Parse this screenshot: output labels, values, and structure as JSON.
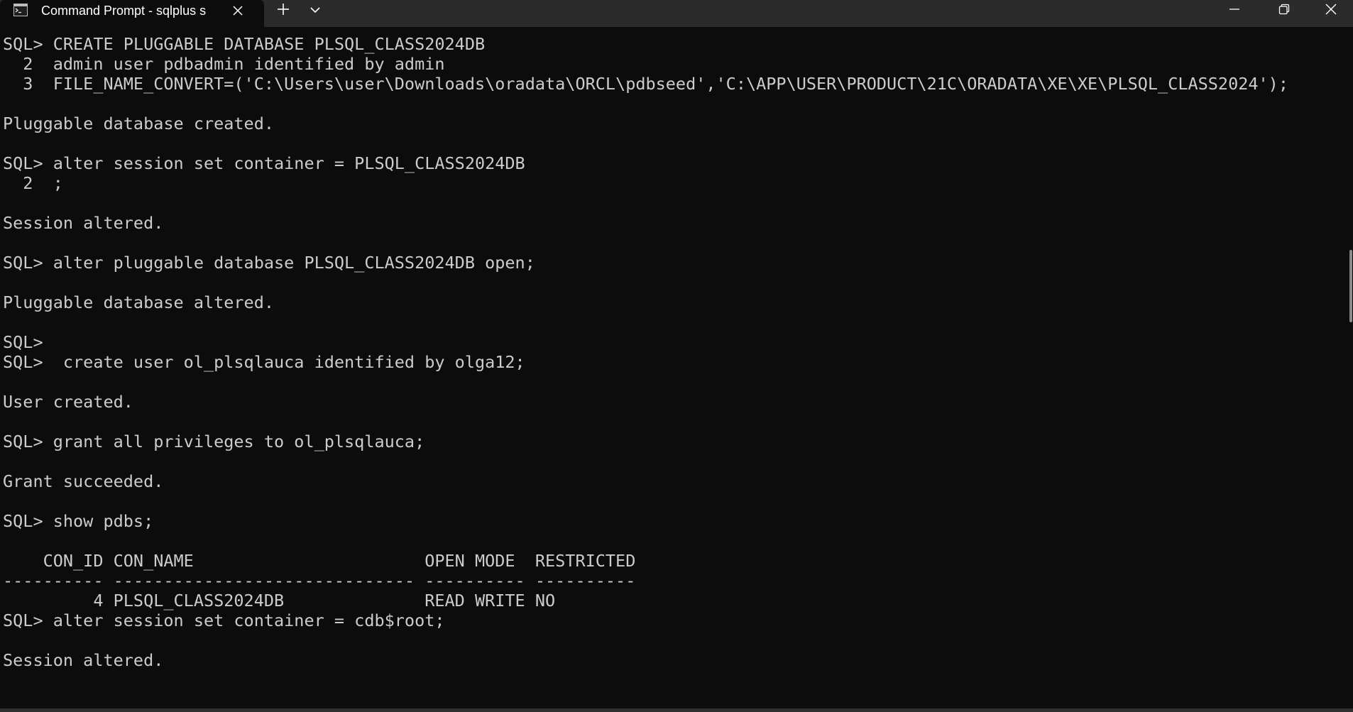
{
  "window": {
    "tab_title": "Command Prompt - sqlplus s",
    "icons": {
      "tab": "terminal-icon",
      "tab_close": "close-icon",
      "new_tab": "plus-icon",
      "dropdown": "chevron-down-icon",
      "minimize": "minimize-icon",
      "maximize": "restore-icon",
      "close": "close-icon"
    }
  },
  "colors": {
    "terminal_background": "#0c0c0c",
    "terminal_text": "#cccccc",
    "titlebar": "#2b2b2b"
  },
  "terminal": {
    "lines": [
      "SQL> CREATE PLUGGABLE DATABASE PLSQL_CLASS2024DB",
      "  2  admin user pdbadmin identified by admin",
      "  3  FILE_NAME_CONVERT=('C:\\Users\\user\\Downloads\\oradata\\ORCL\\pdbseed','C:\\APP\\USER\\PRODUCT\\21C\\ORADATA\\XE\\XE\\PLSQL_CLASS2024');",
      "",
      "Pluggable database created.",
      "",
      "SQL> alter session set container = PLSQL_CLASS2024DB",
      "  2  ;",
      "",
      "Session altered.",
      "",
      "SQL> alter pluggable database PLSQL_CLASS2024DB open;",
      "",
      "Pluggable database altered.",
      "",
      "SQL>",
      "SQL>  create user ol_plsqlauca identified by olga12;",
      "",
      "User created.",
      "",
      "SQL> grant all privileges to ol_plsqlauca;",
      "",
      "Grant succeeded.",
      "",
      "SQL> show pdbs;",
      "",
      "    CON_ID CON_NAME                       OPEN MODE  RESTRICTED",
      "---------- ------------------------------ ---------- ----------",
      "         4 PLSQL_CLASS2024DB              READ WRITE NO",
      "SQL> alter session set container = cdb$root;",
      "",
      "Session altered.",
      ""
    ]
  }
}
